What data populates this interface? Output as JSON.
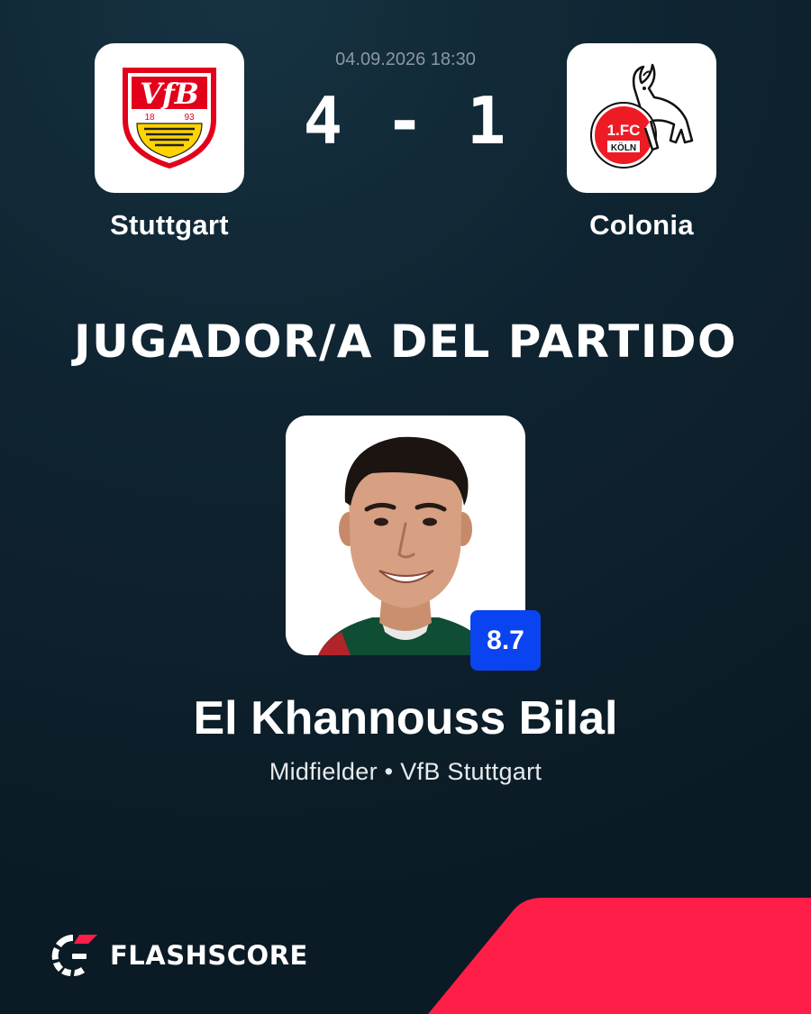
{
  "match": {
    "datetime": "04.09.2026 18:30",
    "score": "4 - 1",
    "home_team": {
      "name": "Stuttgart",
      "crest_text": "VfB",
      "crest_year_left": "18",
      "crest_year_right": "93",
      "crest_icon": "vfb-stuttgart-crest-icon"
    },
    "away_team": {
      "name": "Colonia",
      "crest_text": "1.FC",
      "crest_subtext": "KÖLN",
      "crest_icon": "fc-koln-crest-icon"
    }
  },
  "potm": {
    "heading": "JUGADOR/A DEL PARTIDO",
    "player_name": "El Khannouss Bilal",
    "subtitle": "Midfielder • VfB Stuttgart",
    "rating": "8.7",
    "photo_icon": "player-photo"
  },
  "brand": {
    "name": "FLASHSCORE",
    "logo_icon": "flashscore-logo-icon"
  },
  "colors": {
    "background": "#0f2431",
    "rating_badge": "#0a44f0",
    "accent_stripe": "#ff1e48",
    "vfb_red": "#e3001b",
    "vfb_yellow": "#ffd400",
    "koln_red": "#ed1c24"
  }
}
